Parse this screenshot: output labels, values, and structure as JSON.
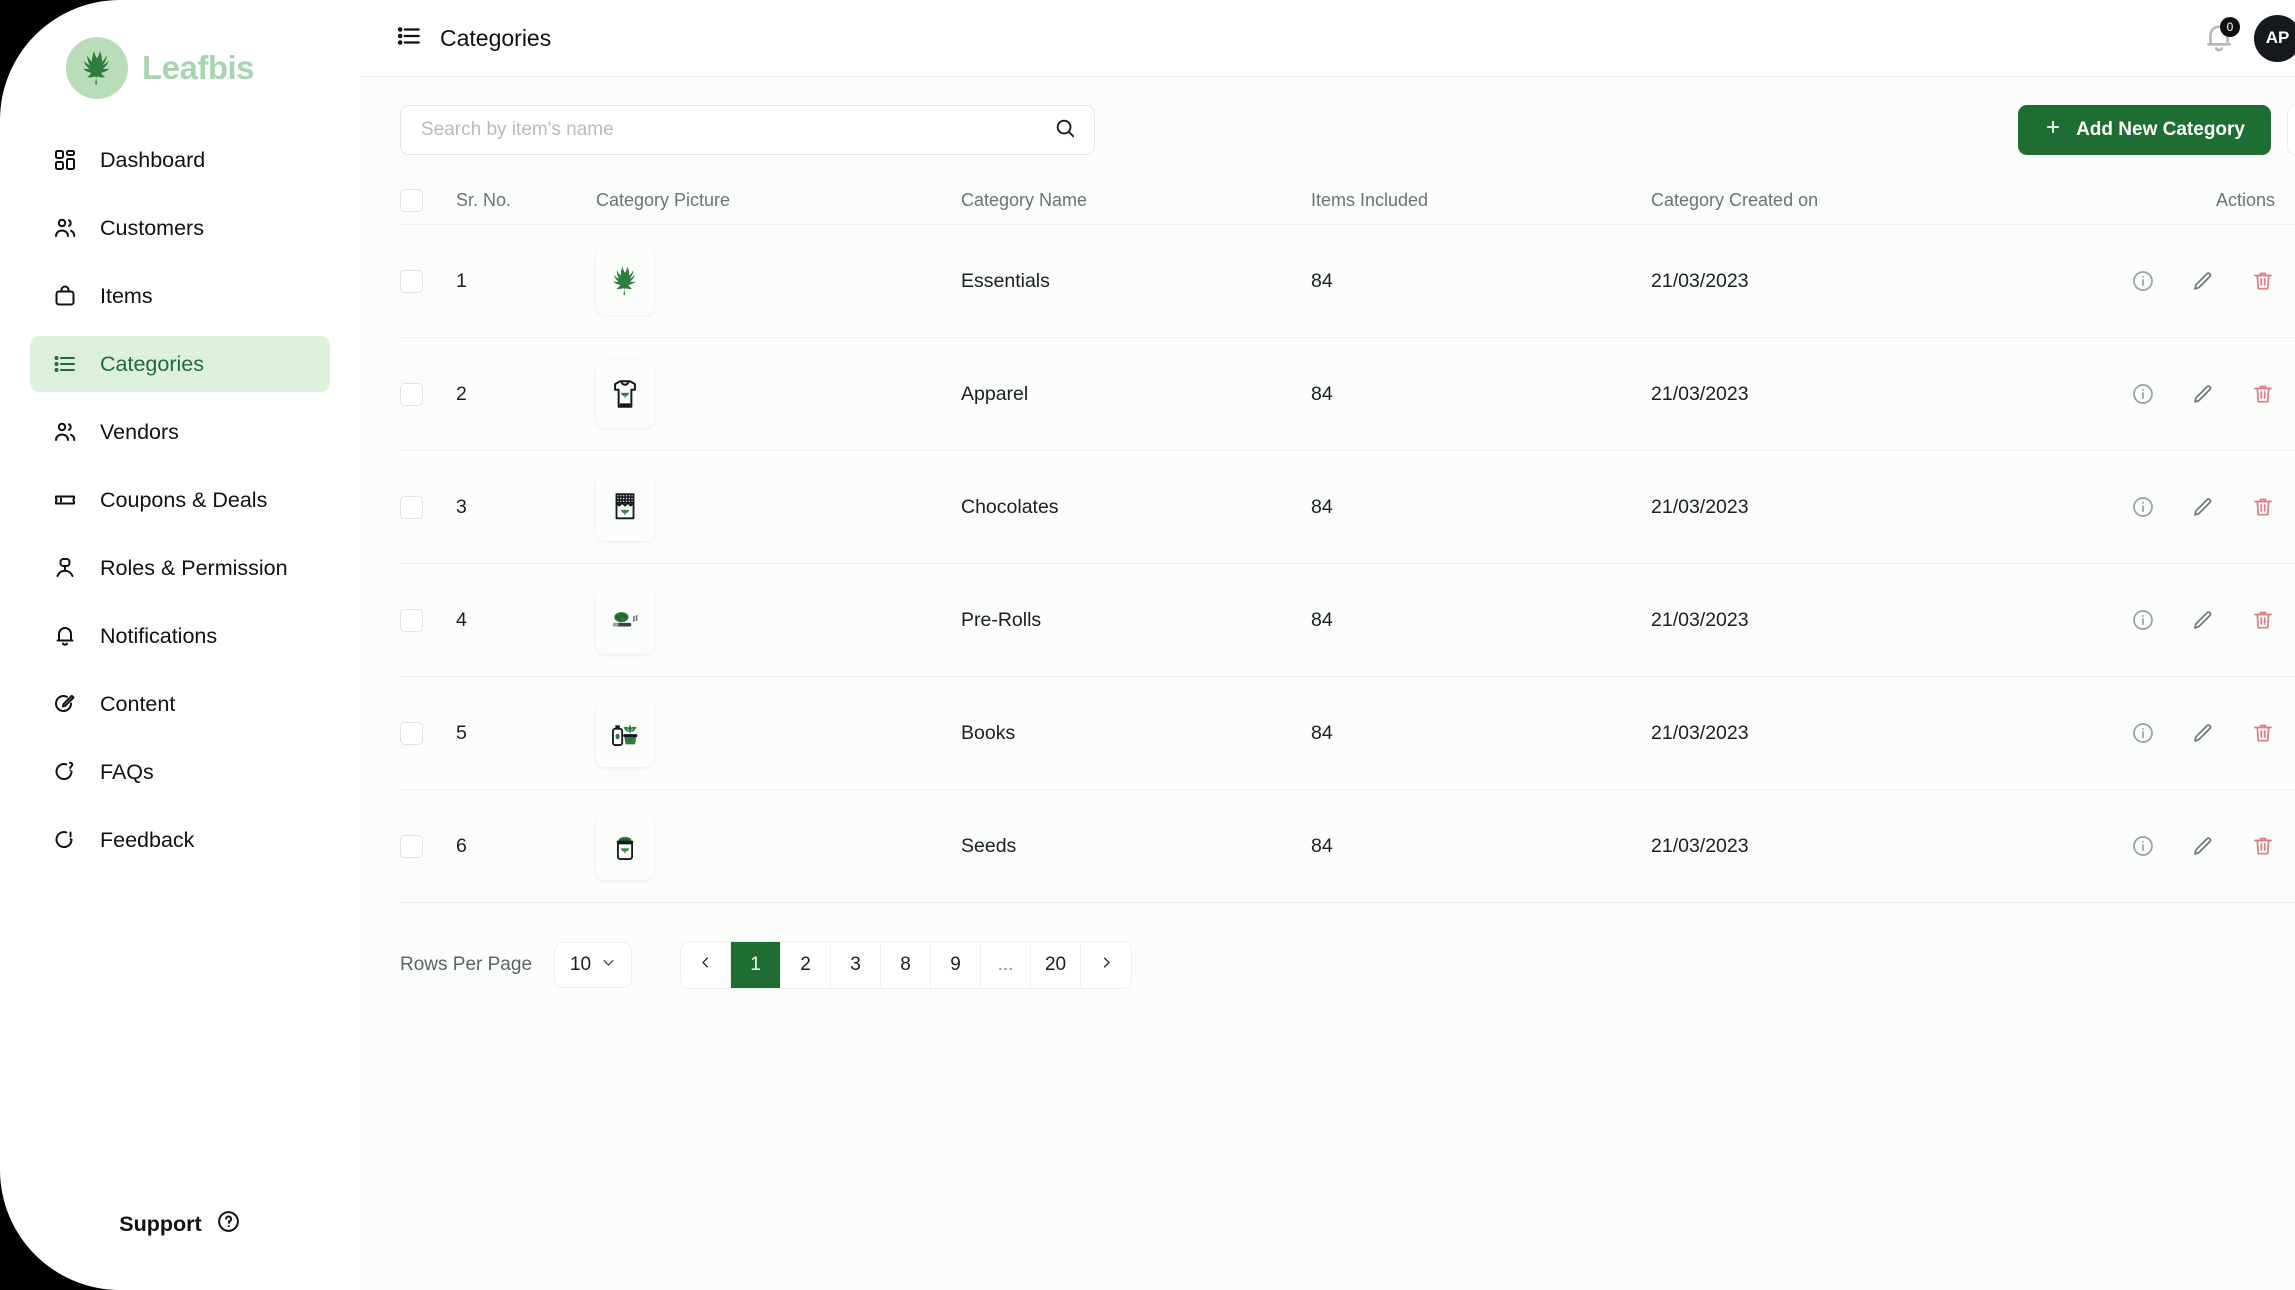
{
  "brand": {
    "name": "Leafbis",
    "logo_icon": "cannabis-leaf-icon",
    "accent": "#1e6e33",
    "accent_light": "#dcf0dc"
  },
  "sidebar": {
    "items": [
      {
        "label": "Dashboard",
        "icon": "grid-icon",
        "active": false
      },
      {
        "label": "Customers",
        "icon": "users-icon",
        "active": false
      },
      {
        "label": "Items",
        "icon": "bag-icon",
        "active": false
      },
      {
        "label": "Categories",
        "icon": "list-icon",
        "active": true
      },
      {
        "label": "Vendors",
        "icon": "users-icon",
        "active": false
      },
      {
        "label": "Coupons & Deals",
        "icon": "ticket-icon",
        "active": false
      },
      {
        "label": "Roles & Permission",
        "icon": "user-shield-icon",
        "active": false
      },
      {
        "label": "Notifications",
        "icon": "bell-icon",
        "active": false
      },
      {
        "label": "Content",
        "icon": "pencil-circle-icon",
        "active": false
      },
      {
        "label": "FAQs",
        "icon": "question-circle-icon",
        "active": false
      },
      {
        "label": "Feedback",
        "icon": "info-circle-icon",
        "active": false
      }
    ],
    "support_label": "Support",
    "support_icon": "question-mark-circle-icon"
  },
  "header": {
    "menu_icon": "list-menu-icon",
    "title": "Categories",
    "bell_icon": "bell-icon",
    "notification_count": "0",
    "avatar_initials": "AP",
    "caret_icon": "chevron-down-icon"
  },
  "toolbar": {
    "search_placeholder": "Search by item's name",
    "search_value": "",
    "search_icon": "search-icon",
    "add_label": "Add New Category",
    "add_icon": "plus-icon",
    "filter_icon": "filter-funnel-icon"
  },
  "table": {
    "columns": [
      "Sr. No.",
      "Category Picture",
      "Category Name",
      "Items Included",
      "Category Created on",
      "Actions"
    ],
    "rows": [
      {
        "sr": "1",
        "picture_icon": "cannabis-leaf-icon",
        "name": "Essentials",
        "items": "84",
        "created": "21/03/2023"
      },
      {
        "sr": "2",
        "picture_icon": "tshirt-leaf-icon",
        "name": "Apparel",
        "items": "84",
        "created": "21/03/2023"
      },
      {
        "sr": "3",
        "picture_icon": "chocolate-bar-icon",
        "name": "Chocolates",
        "items": "84",
        "created": "21/03/2023"
      },
      {
        "sr": "4",
        "picture_icon": "pre-roll-icon",
        "name": "Pre-Rolls",
        "items": "84",
        "created": "21/03/2023"
      },
      {
        "sr": "5",
        "picture_icon": "cream-plant-icon",
        "name": "Books",
        "items": "84",
        "created": "21/03/2023"
      },
      {
        "sr": "6",
        "picture_icon": "seed-jar-icon",
        "name": "Seeds",
        "items": "84",
        "created": "21/03/2023"
      }
    ],
    "action_icons": [
      "info-circle-icon",
      "pencil-edit-icon",
      "trash-delete-icon"
    ],
    "delete_color": "#e07a85"
  },
  "pagination": {
    "rows_per_page_label": "Rows Per Page",
    "rows_per_page_value": "10",
    "prev_icon": "chevron-left-icon",
    "next_icon": "chevron-right-icon",
    "pages": [
      "1",
      "2",
      "3",
      "8",
      "9",
      "...",
      "20"
    ],
    "active_page": "1"
  }
}
